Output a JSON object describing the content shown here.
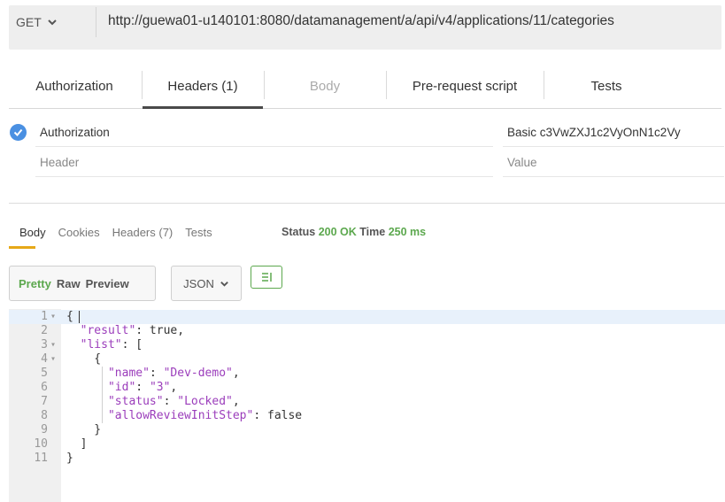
{
  "request": {
    "method": "GET",
    "url": "http://guewa01-u140101:8080/datamanagement/a/api/v4/applications/11/categories"
  },
  "request_tabs": [
    {
      "label": "Authorization"
    },
    {
      "label": "Headers (1)"
    },
    {
      "label": "Body"
    },
    {
      "label": "Pre-request script"
    },
    {
      "label": "Tests"
    }
  ],
  "headers": {
    "row1_key": "Authorization",
    "row1_value": "Basic c3VwZXJ1c2VyOnN1c2Vy",
    "key_placeholder": "Header",
    "value_placeholder": "Value"
  },
  "response": {
    "tabs": [
      "Body",
      "Cookies",
      "Headers (7)",
      "Tests"
    ],
    "status_label": "Status",
    "status_value": "200 OK",
    "time_label": "Time",
    "time_value": "250 ms"
  },
  "view": {
    "modes": [
      "Pretty",
      "Raw",
      "Preview"
    ],
    "format": "JSON"
  },
  "code_lines": [
    {
      "n": "1",
      "fold": true,
      "text": "{"
    },
    {
      "n": "2",
      "fold": false,
      "text": "  \"result\": true,"
    },
    {
      "n": "3",
      "fold": true,
      "text": "  \"list\": ["
    },
    {
      "n": "4",
      "fold": true,
      "text": "    {"
    },
    {
      "n": "5",
      "fold": false,
      "text": "      \"name\": \"Dev-demo\","
    },
    {
      "n": "6",
      "fold": false,
      "text": "      \"id\": \"3\","
    },
    {
      "n": "7",
      "fold": false,
      "text": "      \"status\": \"Locked\","
    },
    {
      "n": "8",
      "fold": false,
      "text": "      \"allowReviewInitStep\": false"
    },
    {
      "n": "9",
      "fold": false,
      "text": "    }"
    },
    {
      "n": "10",
      "fold": false,
      "text": "  ]"
    },
    {
      "n": "11",
      "fold": false,
      "text": "}"
    }
  ],
  "colors": {
    "accent_green": "#5ca84e",
    "accent_orange": "#e6a817",
    "check_blue": "#4a90e2",
    "json_string": "#9b3dbb"
  }
}
